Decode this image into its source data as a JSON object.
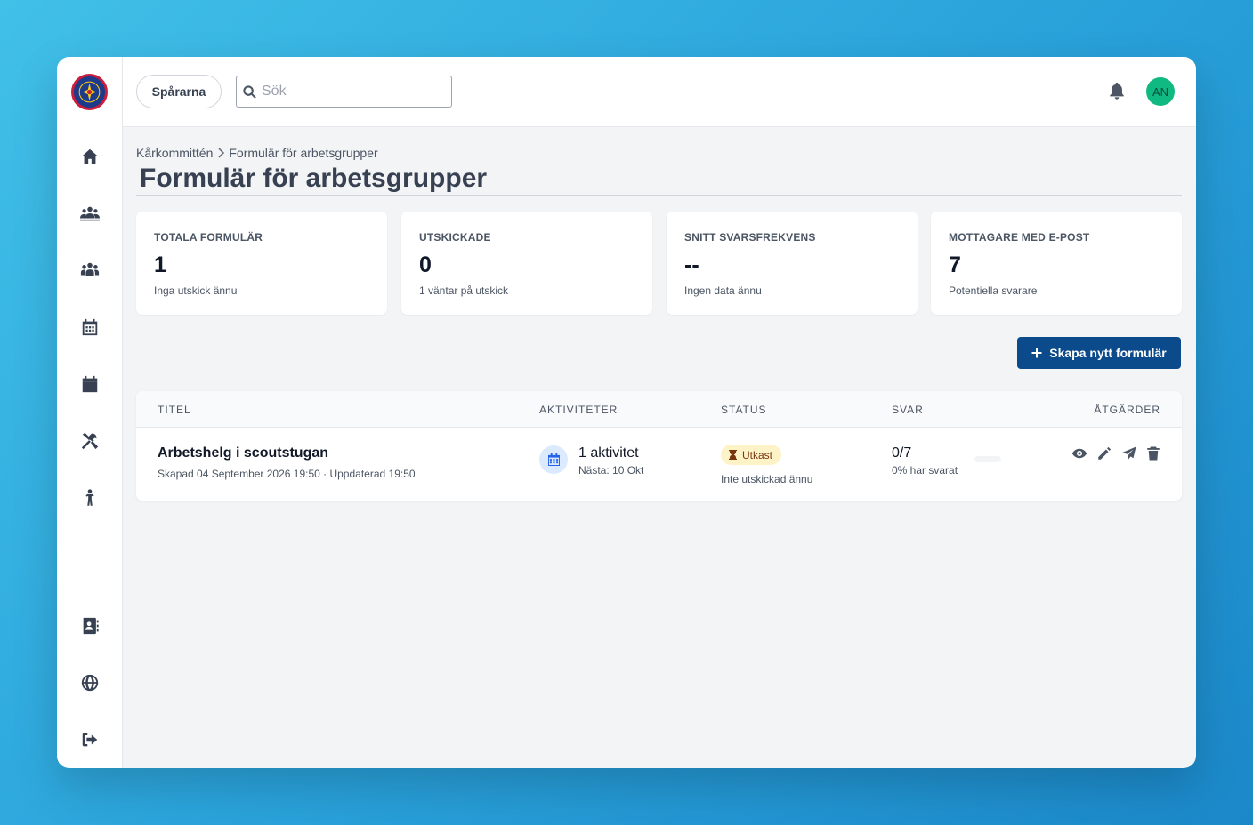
{
  "topbar": {
    "org_button": "Spårarna",
    "search_placeholder": "Sök",
    "avatar_initials": "AN"
  },
  "breadcrumb": {
    "parent": "Kårkommittén",
    "current": "Formulär för arbetsgrupper"
  },
  "page": {
    "title": "Formulär för arbetsgrupper"
  },
  "stats": [
    {
      "label": "TOTALA FORMULÄR",
      "value": "1",
      "sub": "Inga utskick ännu"
    },
    {
      "label": "UTSKICKADE",
      "value": "0",
      "sub": "1 väntar på utskick"
    },
    {
      "label": "SNITT SVARSFREKVENS",
      "value": "--",
      "sub": "Ingen data ännu"
    },
    {
      "label": "MOTTAGARE MED E-POST",
      "value": "7",
      "sub": "Potentiella svarare"
    }
  ],
  "create_button": "Skapa nytt formulär",
  "table": {
    "headers": [
      "TITEL",
      "AKTIVITETER",
      "STATUS",
      "SVAR",
      "ÅTGÄRDER"
    ],
    "rows": [
      {
        "title": "Arbetshelg i scoutstugan",
        "meta": "Skapad 04 September 2026 19:50 · Uppdaterad 19:50",
        "activities": "1 aktivitet",
        "next": "Nästa: 10 Okt",
        "status": "Utkast",
        "status_note": "Inte utskickad ännu",
        "responses": "0/7",
        "response_pct_text": "0% har svarat",
        "response_fraction": 0
      }
    ]
  },
  "sidebar": {
    "icons": [
      "home-icon",
      "group-icon",
      "users-icon",
      "calendar-grid-icon",
      "calendar-icon",
      "tools-icon",
      "child-icon",
      "contacts-icon",
      "globe-icon",
      "logout-icon"
    ]
  },
  "colors": {
    "primary": "#0b4a8b",
    "avatar": "#10b981",
    "badge_draft": "#fef3c7",
    "activity_icon_bg": "#dbeafe"
  }
}
